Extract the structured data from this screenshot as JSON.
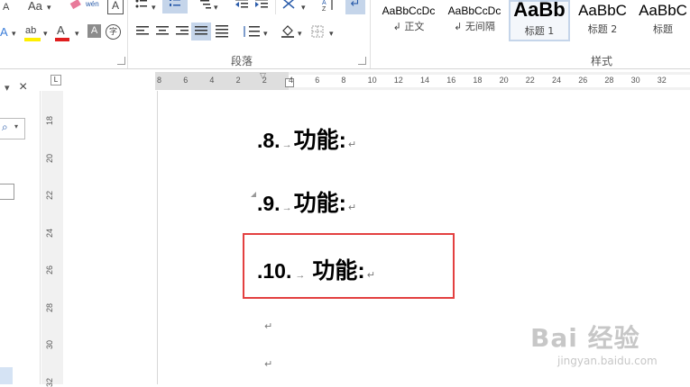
{
  "ribbon": {
    "font_group": {
      "row1": [
        "A",
        "Aa",
        "wén",
        "A"
      ],
      "row2": [
        "A",
        "ab",
        "A",
        "A",
        "字"
      ]
    },
    "paragraph_group": {
      "label": "段落"
    },
    "styles_group": {
      "label": "样式",
      "styles": [
        {
          "sample": "AaBbCcDc",
          "name": "↲ 正文"
        },
        {
          "sample": "AaBbCcDc",
          "name": "↲ 无间隔"
        },
        {
          "sample": "AaBb",
          "name": "标题 1"
        },
        {
          "sample": "AaBbC",
          "name": "标题 2"
        },
        {
          "sample": "AaBbC",
          "name": "标题"
        }
      ]
    }
  },
  "pane": {
    "close_glyph": "×",
    "dropdown_glyph": "▾",
    "search_glyph": "⌕"
  },
  "ruler": {
    "corner_glyph": "L",
    "horizontal_ticks": [
      "8",
      "6",
      "4",
      "2",
      "2",
      "4",
      "6",
      "8",
      "10",
      "12",
      "14",
      "16",
      "18",
      "20",
      "22",
      "24",
      "26",
      "28",
      "30",
      "32"
    ],
    "vertical_ticks": [
      "18",
      "20",
      "22",
      "24",
      "26",
      "28",
      "30",
      "32"
    ]
  },
  "document": {
    "headings": [
      {
        "number": ".8.",
        "text": "功能:"
      },
      {
        "number": ".9.",
        "text": "功能:"
      },
      {
        "number": ".10.",
        "text": "功能:"
      }
    ],
    "tab_arrow": "→",
    "paragraph_mark": "↵"
  },
  "watermark": {
    "brand": "Bai 经验",
    "url": "jingyan.baidu.com"
  },
  "colors": {
    "highlight_box": "#e34040",
    "selected_style_border": "#c5d5ea"
  }
}
